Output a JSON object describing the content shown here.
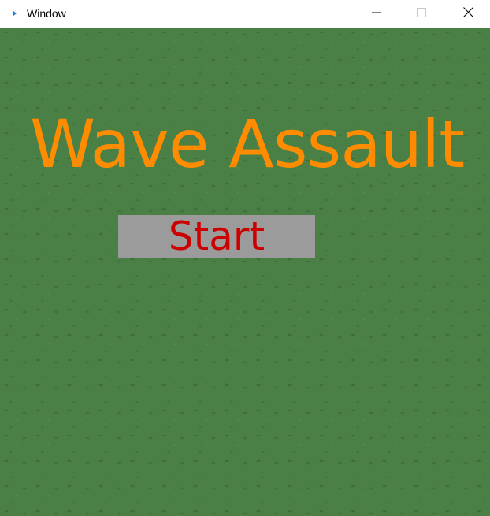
{
  "window": {
    "title": "Window",
    "icon": "app-icon",
    "controls": {
      "minimize_icon": "minimize-icon",
      "maximize_icon": "maximize-icon",
      "close_icon": "close-icon"
    }
  },
  "game": {
    "title": "Wave Assault",
    "start_label": "Start",
    "colors": {
      "background": "#4a7f45",
      "title": "#ff8c00",
      "button_bg": "#9b9b9b",
      "button_text": "#cc0000"
    }
  }
}
